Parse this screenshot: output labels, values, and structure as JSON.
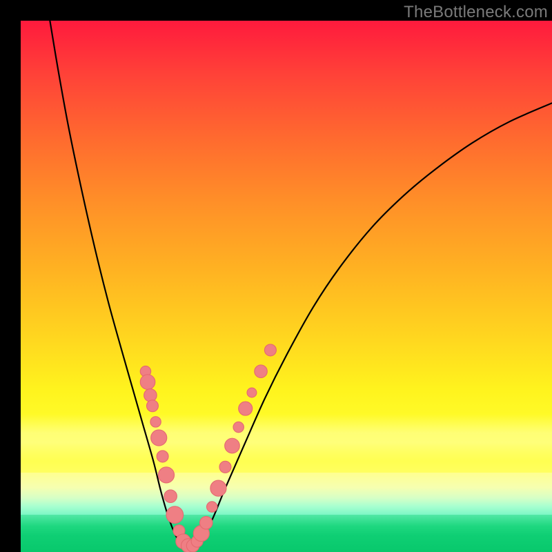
{
  "watermark": "TheBottleneck.com",
  "colors": {
    "frame": "#000000",
    "curve": "#000000",
    "marker_fill": "#ef7f84",
    "marker_stroke": "#e56a70"
  },
  "chart_data": {
    "type": "line",
    "title": "",
    "xlabel": "",
    "ylabel": "",
    "xlim": [
      0,
      100
    ],
    "ylim": [
      0,
      100
    ],
    "grid": false,
    "curve_points": [
      {
        "x": 5.5,
        "y": 100.0
      },
      {
        "x": 7.0,
        "y": 91.0
      },
      {
        "x": 9.0,
        "y": 80.0
      },
      {
        "x": 11.5,
        "y": 68.0
      },
      {
        "x": 14.0,
        "y": 57.0
      },
      {
        "x": 16.5,
        "y": 47.0
      },
      {
        "x": 19.0,
        "y": 38.0
      },
      {
        "x": 21.0,
        "y": 31.0
      },
      {
        "x": 23.0,
        "y": 24.0
      },
      {
        "x": 25.0,
        "y": 17.0
      },
      {
        "x": 26.5,
        "y": 11.0
      },
      {
        "x": 28.0,
        "y": 6.0
      },
      {
        "x": 29.5,
        "y": 2.5
      },
      {
        "x": 31.0,
        "y": 1.0
      },
      {
        "x": 32.5,
        "y": 1.0
      },
      {
        "x": 34.0,
        "y": 2.5
      },
      {
        "x": 36.0,
        "y": 6.0
      },
      {
        "x": 38.5,
        "y": 12.0
      },
      {
        "x": 42.0,
        "y": 20.0
      },
      {
        "x": 46.0,
        "y": 29.0
      },
      {
        "x": 50.0,
        "y": 37.0
      },
      {
        "x": 55.0,
        "y": 46.0
      },
      {
        "x": 60.0,
        "y": 53.5
      },
      {
        "x": 66.0,
        "y": 61.0
      },
      {
        "x": 72.0,
        "y": 67.0
      },
      {
        "x": 78.0,
        "y": 72.0
      },
      {
        "x": 85.0,
        "y": 77.0
      },
      {
        "x": 92.0,
        "y": 81.0
      },
      {
        "x": 100.0,
        "y": 84.5
      }
    ],
    "markers": [
      {
        "x": 23.5,
        "y": 34.0,
        "r": 1.0
      },
      {
        "x": 23.9,
        "y": 32.0,
        "r": 1.4
      },
      {
        "x": 24.4,
        "y": 29.5,
        "r": 1.2
      },
      {
        "x": 24.8,
        "y": 27.5,
        "r": 1.1
      },
      {
        "x": 25.4,
        "y": 24.5,
        "r": 1.0
      },
      {
        "x": 26.0,
        "y": 21.5,
        "r": 1.5
      },
      {
        "x": 26.7,
        "y": 18.0,
        "r": 1.1
      },
      {
        "x": 27.4,
        "y": 14.5,
        "r": 1.5
      },
      {
        "x": 28.2,
        "y": 10.5,
        "r": 1.2
      },
      {
        "x": 29.0,
        "y": 7.0,
        "r": 1.6
      },
      {
        "x": 29.8,
        "y": 4.0,
        "r": 1.1
      },
      {
        "x": 30.6,
        "y": 2.0,
        "r": 1.4
      },
      {
        "x": 31.5,
        "y": 1.2,
        "r": 1.3
      },
      {
        "x": 32.4,
        "y": 1.2,
        "r": 1.2
      },
      {
        "x": 33.2,
        "y": 2.0,
        "r": 1.1
      },
      {
        "x": 34.0,
        "y": 3.5,
        "r": 1.5
      },
      {
        "x": 34.9,
        "y": 5.5,
        "r": 1.2
      },
      {
        "x": 36.0,
        "y": 8.5,
        "r": 1.0
      },
      {
        "x": 37.2,
        "y": 12.0,
        "r": 1.5
      },
      {
        "x": 38.5,
        "y": 16.0,
        "r": 1.1
      },
      {
        "x": 39.8,
        "y": 20.0,
        "r": 1.4
      },
      {
        "x": 41.0,
        "y": 23.5,
        "r": 1.0
      },
      {
        "x": 42.3,
        "y": 27.0,
        "r": 1.3
      },
      {
        "x": 43.5,
        "y": 30.0,
        "r": 0.9
      },
      {
        "x": 45.2,
        "y": 34.0,
        "r": 1.2
      },
      {
        "x": 47.0,
        "y": 38.0,
        "r": 1.1
      }
    ]
  }
}
